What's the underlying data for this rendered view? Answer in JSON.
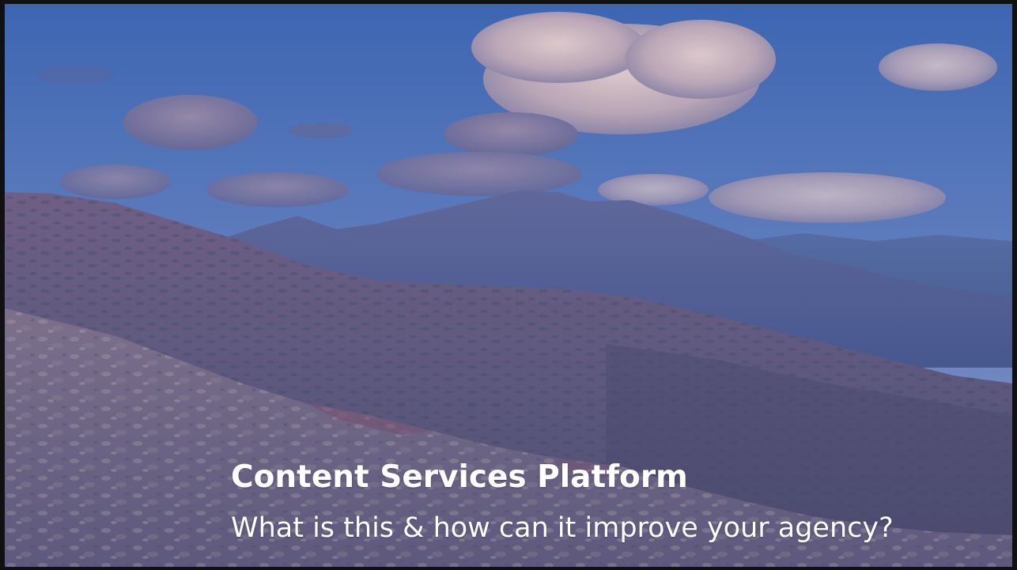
{
  "slide": {
    "title": "Content Services Platform",
    "subtitle": "What is this & how can it improve your agency?",
    "background_image": "mountain-landscape-photo"
  },
  "colors": {
    "sky_top": "#4a70b8",
    "sky_bottom": "#9eaede",
    "cloud": "#d9c2c6",
    "cloud_shadow": "#7f7aa0",
    "far_mountain": "#5b6a9c",
    "mid_ridge": "#6c5f86",
    "foreground_rock": "#8a7c8e",
    "text": "#ffffff",
    "border": "#111111"
  }
}
